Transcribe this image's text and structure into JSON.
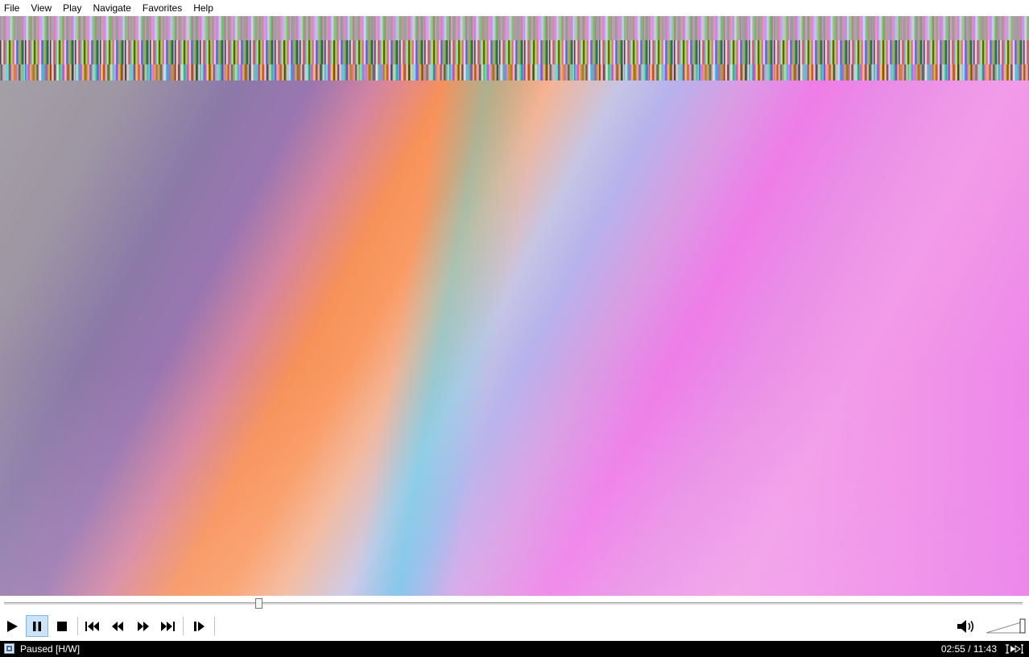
{
  "menu": {
    "items": [
      "File",
      "View",
      "Play",
      "Navigate",
      "Favorites",
      "Help"
    ]
  },
  "playback": {
    "position_fraction": 0.2504
  },
  "controls": {
    "buttons": [
      {
        "name": "play",
        "icon": "play-icon"
      },
      {
        "name": "pause",
        "icon": "pause-icon",
        "active": true
      },
      {
        "name": "stop",
        "icon": "stop-icon"
      },
      {
        "name": "previous",
        "icon": "skip-previous-icon"
      },
      {
        "name": "rewind",
        "icon": "rewind-icon"
      },
      {
        "name": "fast-forward",
        "icon": "fast-forward-icon"
      },
      {
        "name": "next",
        "icon": "skip-next-icon"
      },
      {
        "name": "frame-step",
        "icon": "frame-step-icon"
      }
    ],
    "volume_icon": "speaker-icon",
    "volume_level": 1.0
  },
  "status": {
    "text": "Paused [H/W]",
    "time": "02:55 / 11:43"
  },
  "colors": {
    "accent": "#cce4f7",
    "statusbar_bg": "#000000"
  }
}
